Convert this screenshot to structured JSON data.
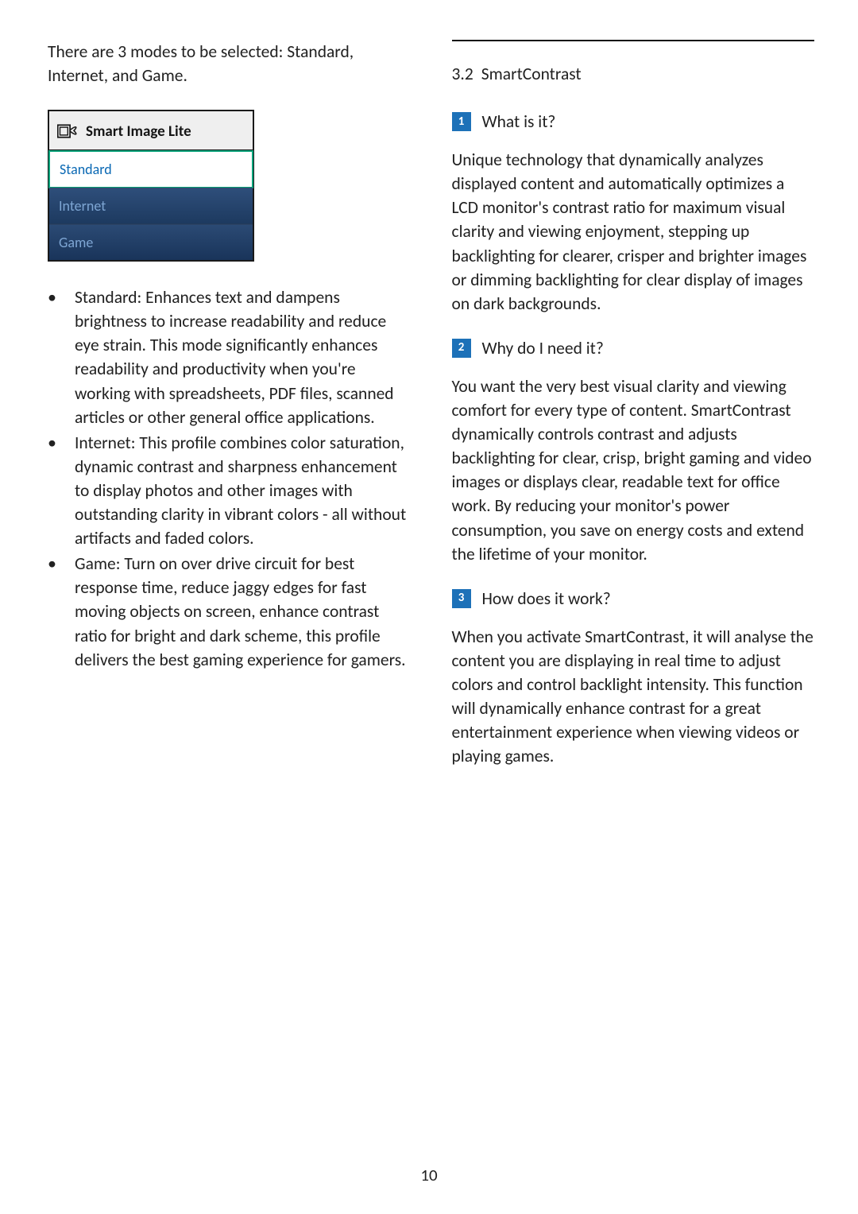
{
  "left": {
    "intro": "There are 3 modes to be selected: Standard, Internet, and Game.",
    "menu": {
      "title": "Smart Image Lite",
      "items": [
        {
          "label": "Standard",
          "active": true
        },
        {
          "label": "Internet",
          "active": false
        },
        {
          "label": "Game",
          "active": false
        }
      ]
    },
    "bullets": [
      {
        "label": "Standard:",
        "text": " Enhances text and dampens brightness to increase readability and reduce eye strain. This mode significantly enhances readability and productivity when you're working with spreadsheets, PDF files, scanned articles or other general office applications."
      },
      {
        "label": "Internet:",
        "text": " This profile combines color saturation, dynamic contrast and sharpness enhancement to display photos and other images with outstanding clarity in vibrant colors - all without artifacts and faded colors."
      },
      {
        "label": "Game:",
        "text": " Turn on over drive circuit for best response time, reduce jaggy edges for fast moving objects on screen, enhance contrast ratio for bright and dark scheme, this profile delivers the best gaming experience for gamers."
      }
    ]
  },
  "right": {
    "section_num": "3.2",
    "section_title": "SmartContrast",
    "qa": [
      {
        "num": "1",
        "q": "What is it?",
        "a": "Unique technology that dynamically analyzes displayed content and automatically optimizes a LCD monitor's contrast ratio for maximum visual clarity and viewing enjoyment, stepping up backlighting for clearer, crisper and brighter images or dimming backlighting for clear display of images on dark backgrounds."
      },
      {
        "num": "2",
        "q": "Why do I need it?",
        "a": "You want the very best visual clarity and viewing comfort for every type of content. SmartContrast dynamically controls contrast and adjusts backlighting for clear, crisp, bright gaming and video images or displays clear, readable text for office work. By reducing your monitor's power consumption, you save on energy costs and extend the lifetime of your monitor."
      },
      {
        "num": "3",
        "q": "How does it work?",
        "a": "When you activate SmartContrast, it will analyse the content you are displaying in real time to adjust colors and control backlight intensity. This function will dynamically enhance contrast for a great entertainment experience when viewing videos or playing games."
      }
    ]
  },
  "page_number": "10"
}
